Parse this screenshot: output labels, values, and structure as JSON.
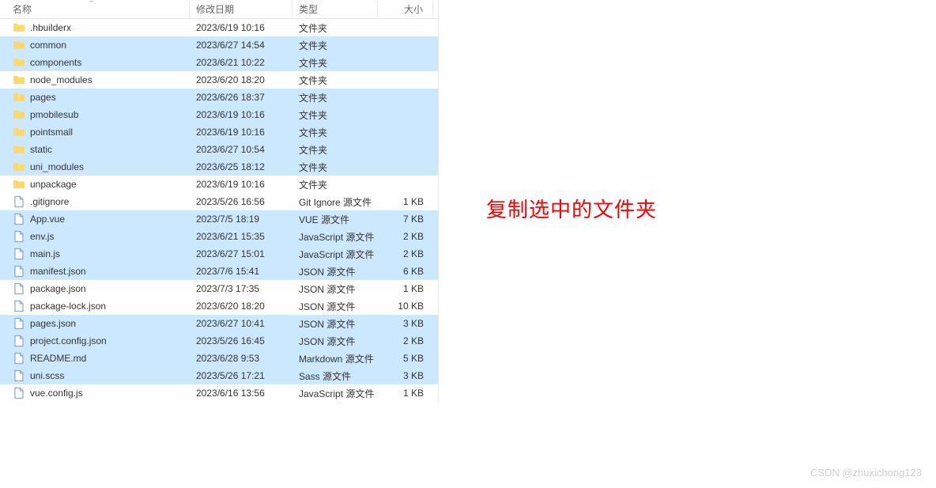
{
  "columns": {
    "name": "名称",
    "date": "修改日期",
    "type": "类型",
    "size": "大小"
  },
  "annotation": "复制选中的文件夹",
  "watermark": "CSDN @zhuxichong123",
  "rows": [
    {
      "icon": "folder",
      "name": ".hbuilderx",
      "date": "2023/6/19 10:16",
      "type": "文件夹",
      "size": "",
      "selected": false
    },
    {
      "icon": "folder",
      "name": "common",
      "date": "2023/6/27 14:54",
      "type": "文件夹",
      "size": "",
      "selected": true
    },
    {
      "icon": "folder",
      "name": "components",
      "date": "2023/6/21 10:22",
      "type": "文件夹",
      "size": "",
      "selected": true
    },
    {
      "icon": "folder",
      "name": "node_modules",
      "date": "2023/6/20 18:20",
      "type": "文件夹",
      "size": "",
      "selected": false
    },
    {
      "icon": "folder",
      "name": "pages",
      "date": "2023/6/26 18:37",
      "type": "文件夹",
      "size": "",
      "selected": true
    },
    {
      "icon": "folder",
      "name": "pmobilesub",
      "date": "2023/6/19 10:16",
      "type": "文件夹",
      "size": "",
      "selected": true
    },
    {
      "icon": "folder",
      "name": "pointsmall",
      "date": "2023/6/19 10:16",
      "type": "文件夹",
      "size": "",
      "selected": true
    },
    {
      "icon": "folder",
      "name": "static",
      "date": "2023/6/27 10:54",
      "type": "文件夹",
      "size": "",
      "selected": true
    },
    {
      "icon": "folder",
      "name": "uni_modules",
      "date": "2023/6/25 18:12",
      "type": "文件夹",
      "size": "",
      "selected": true
    },
    {
      "icon": "folder",
      "name": "unpackage",
      "date": "2023/6/19 10:16",
      "type": "文件夹",
      "size": "",
      "selected": false
    },
    {
      "icon": "file",
      "name": ".gitignore",
      "date": "2023/5/26 16:56",
      "type": "Git Ignore 源文件",
      "size": "1 KB",
      "selected": false
    },
    {
      "icon": "file",
      "name": "App.vue",
      "date": "2023/7/5 18:19",
      "type": "VUE 源文件",
      "size": "7 KB",
      "selected": true
    },
    {
      "icon": "file",
      "name": "env.js",
      "date": "2023/6/21 15:35",
      "type": "JavaScript 源文件",
      "size": "2 KB",
      "selected": true
    },
    {
      "icon": "file",
      "name": "main.js",
      "date": "2023/6/27 15:01",
      "type": "JavaScript 源文件",
      "size": "2 KB",
      "selected": true
    },
    {
      "icon": "file",
      "name": "manifest.json",
      "date": "2023/7/6 15:41",
      "type": "JSON 源文件",
      "size": "6 KB",
      "selected": true
    },
    {
      "icon": "file",
      "name": "package.json",
      "date": "2023/7/3 17:35",
      "type": "JSON 源文件",
      "size": "1 KB",
      "selected": false
    },
    {
      "icon": "file",
      "name": "package-lock.json",
      "date": "2023/6/20 18:20",
      "type": "JSON 源文件",
      "size": "10 KB",
      "selected": false
    },
    {
      "icon": "file",
      "name": "pages.json",
      "date": "2023/6/27 10:41",
      "type": "JSON 源文件",
      "size": "3 KB",
      "selected": true
    },
    {
      "icon": "file",
      "name": "project.config.json",
      "date": "2023/5/26 16:45",
      "type": "JSON 源文件",
      "size": "2 KB",
      "selected": true
    },
    {
      "icon": "file",
      "name": "README.md",
      "date": "2023/6/28 9:53",
      "type": "Markdown 源文件",
      "size": "5 KB",
      "selected": true
    },
    {
      "icon": "file",
      "name": "uni.scss",
      "date": "2023/5/26 17:21",
      "type": "Sass 源文件",
      "size": "3 KB",
      "selected": true
    },
    {
      "icon": "file",
      "name": "vue.config.js",
      "date": "2023/6/16 13:56",
      "type": "JavaScript 源文件",
      "size": "1 KB",
      "selected": false
    }
  ]
}
